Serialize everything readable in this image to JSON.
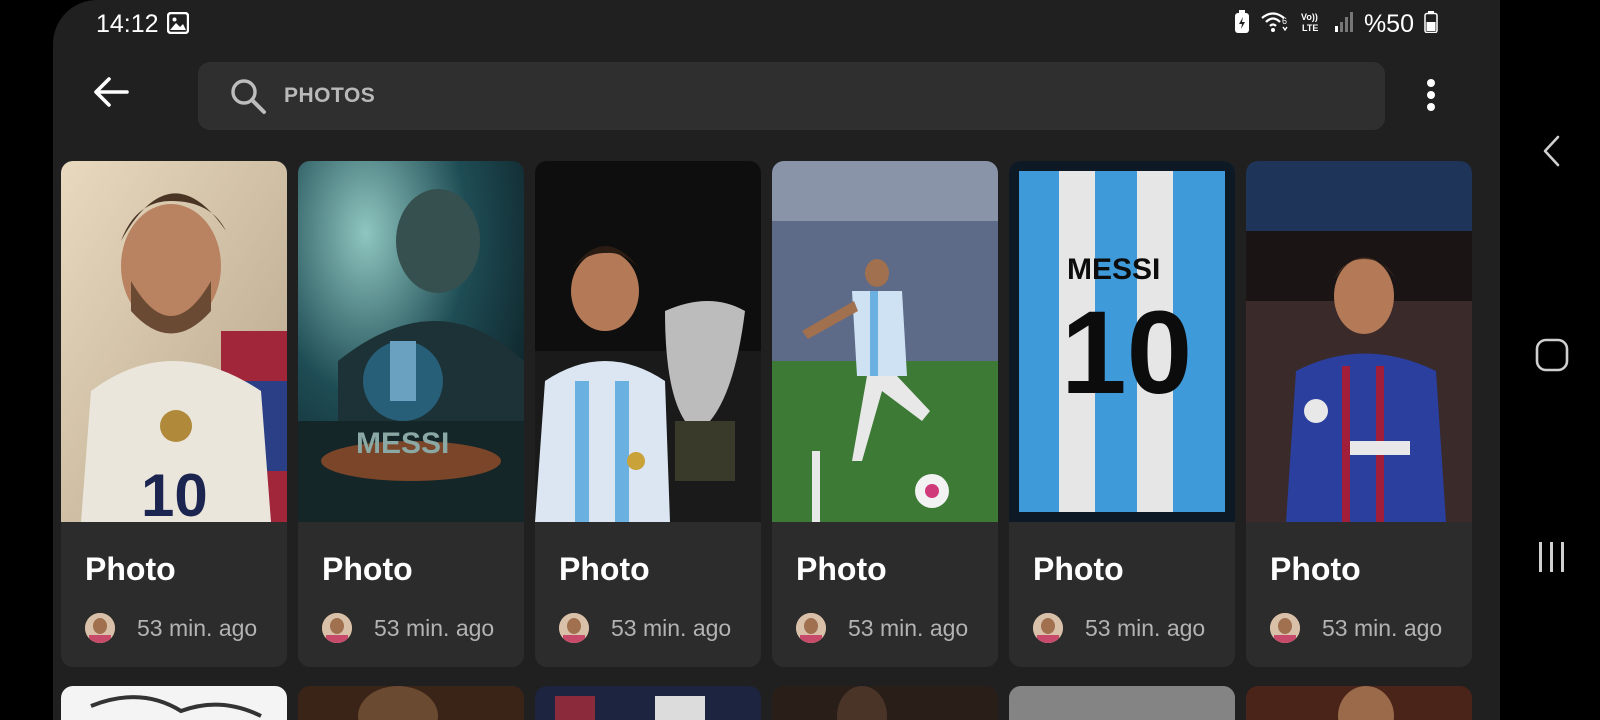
{
  "status_bar": {
    "time": "14:12",
    "battery_label": "%50",
    "icons": [
      "gallery-icon",
      "battery-saver-icon",
      "wifi-6-icon",
      "volte-icon",
      "signal-icon",
      "battery-icon"
    ]
  },
  "header": {
    "back_icon": "arrow-left-icon",
    "search": {
      "value": "PHOTOS",
      "icon": "search-icon"
    },
    "more_icon": "more-vertical-icon"
  },
  "results": [
    {
      "title": "Photo",
      "time": "53 min. ago"
    },
    {
      "title": "Photo",
      "time": "53 min. ago"
    },
    {
      "title": "Photo",
      "time": "53 min. ago"
    },
    {
      "title": "Photo",
      "time": "53 min. ago"
    },
    {
      "title": "Photo",
      "time": "53 min. ago"
    },
    {
      "title": "Photo",
      "time": "53 min. ago"
    }
  ],
  "thumb_art": [
    {
      "text": ""
    },
    {
      "text": "MESSI"
    },
    {
      "text": ""
    },
    {
      "text": ""
    },
    {
      "text": "MESSI",
      "number": "10"
    },
    {
      "text": ""
    }
  ],
  "nav_bar": {
    "icons": [
      "back-chevron-icon",
      "home-icon",
      "recents-icon"
    ]
  },
  "colors": {
    "background": "#202020",
    "card": "#2c2c2c",
    "search_bar": "#2f2f2f",
    "muted_text": "#b3b3b3"
  }
}
